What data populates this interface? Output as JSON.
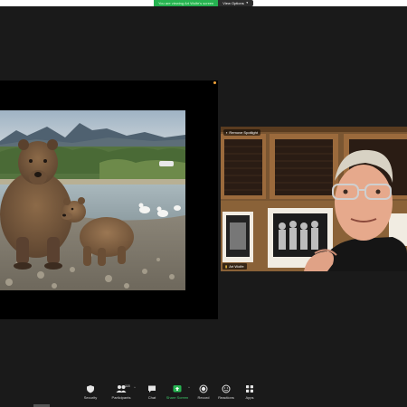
{
  "banner": {
    "message": "You are viewing Art Wolfe's screen",
    "view_options_label": "View Options",
    "message_color": "#26b351"
  },
  "speaker": {
    "spotlight_label": "Remove Spotlight",
    "name": "Art Wolfe"
  },
  "toolbar": {
    "items": [
      {
        "label": "Security",
        "icon": "shield-icon"
      },
      {
        "label": "Participants",
        "icon": "participants-icon",
        "count": "118"
      },
      {
        "label": "Chat",
        "icon": "chat-icon"
      },
      {
        "label": "Share Screen",
        "icon": "share-screen-icon"
      },
      {
        "label": "Record",
        "icon": "record-icon"
      },
      {
        "label": "Reactions",
        "icon": "reactions-icon"
      },
      {
        "label": "Apps",
        "icon": "apps-icon"
      }
    ],
    "share_color": "#3fc96a"
  },
  "colors": {
    "background": "#1a1a1a",
    "accent_green": "#26b351"
  }
}
